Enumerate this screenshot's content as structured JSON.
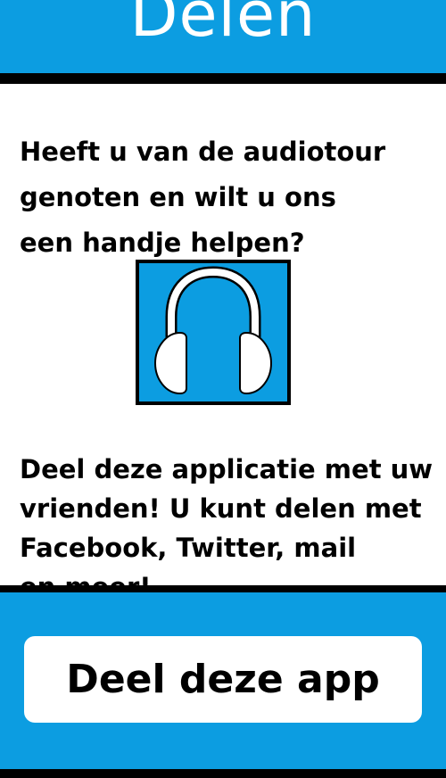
{
  "header": {
    "title": "Delen"
  },
  "content": {
    "intro": "Heeft u van de audiotour\ngenoten en wilt u ons\neen handje helpen?",
    "icon": "headphones-icon",
    "body": "Deel deze applicatie met uw\nvrienden! U kunt delen met\nFacebook, Twitter, mail\nen meer!"
  },
  "footer": {
    "share_button_label": "Deel deze app"
  },
  "colors": {
    "accent": "#0c9de1",
    "text": "#000000",
    "background": "#ffffff"
  }
}
